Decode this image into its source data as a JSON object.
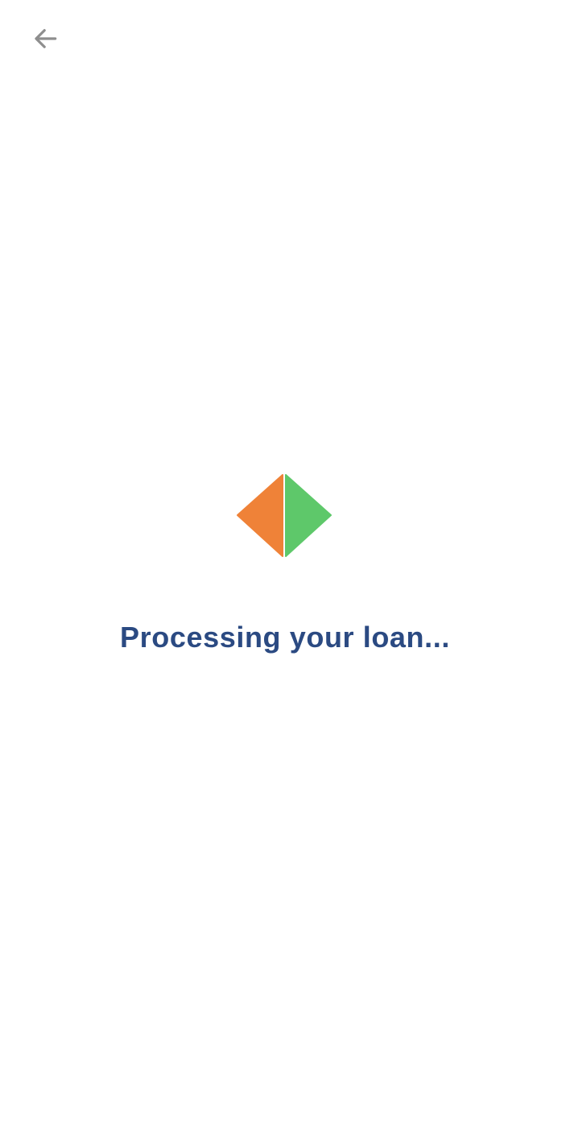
{
  "header": {
    "back_icon": "arrow-left-icon",
    "colors": {
      "icon": "#8e8e8e"
    }
  },
  "logo": {
    "icon": "diamond-split-logo",
    "colors": {
      "left": "#ef8238",
      "right": "#5ec86a"
    }
  },
  "status": {
    "message": "Processing your loan...",
    "color": "#2b4a82"
  }
}
